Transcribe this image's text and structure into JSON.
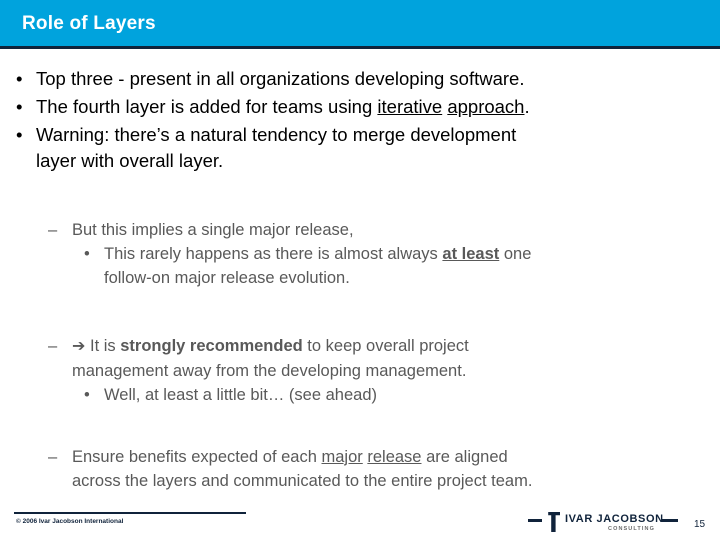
{
  "slide": {
    "title": "Role of Layers",
    "accent_color": "#00A3DD",
    "rule_color": "#10233B",
    "body_color": "#000000",
    "sub_color": "#595959"
  },
  "bullets": {
    "b1_marker": "•",
    "b1_text": "Top three - present in all organizations developing software.",
    "b2_marker": "•",
    "b2_part1": "The fourth layer is added for teams using ",
    "b2_u1": "iterative",
    "b2_space": " ",
    "b2_u2": "approach",
    "b2_part2": ".",
    "b3_marker": "•",
    "b3_line1": "Warning:  there’s a natural tendency to merge development",
    "b3_line2": "layer with overall layer."
  },
  "sub1": {
    "dash": "–",
    "text": "But this implies a single major release,",
    "dot": "•",
    "child_part1": "This rarely happens as there is almost always ",
    "child_bold_u": "at least",
    "child_part2": " one",
    "child_line2": "follow-on major release evolution."
  },
  "sub2": {
    "dash": "–",
    "arrow": "➔",
    "part1": " It is ",
    "bold": "strongly recommended",
    "part2": " to keep overall project",
    "line2": "management away from the developing management.",
    "dot": "•",
    "child": "Well, at least a little bit… (see ahead)"
  },
  "sub3": {
    "dash": "–",
    "part1": "Ensure benefits expected of each ",
    "u1": "major",
    "space": " ",
    "u2": "release",
    "part2": " are aligned",
    "line2": "across the layers and communicated to the entire project team."
  },
  "footer": {
    "copyright": "© 2006 Ivar Jacobson International",
    "logo_name": "IVAR JACOBSON",
    "logo_sub": "CONSULTING",
    "page_number": "15"
  }
}
